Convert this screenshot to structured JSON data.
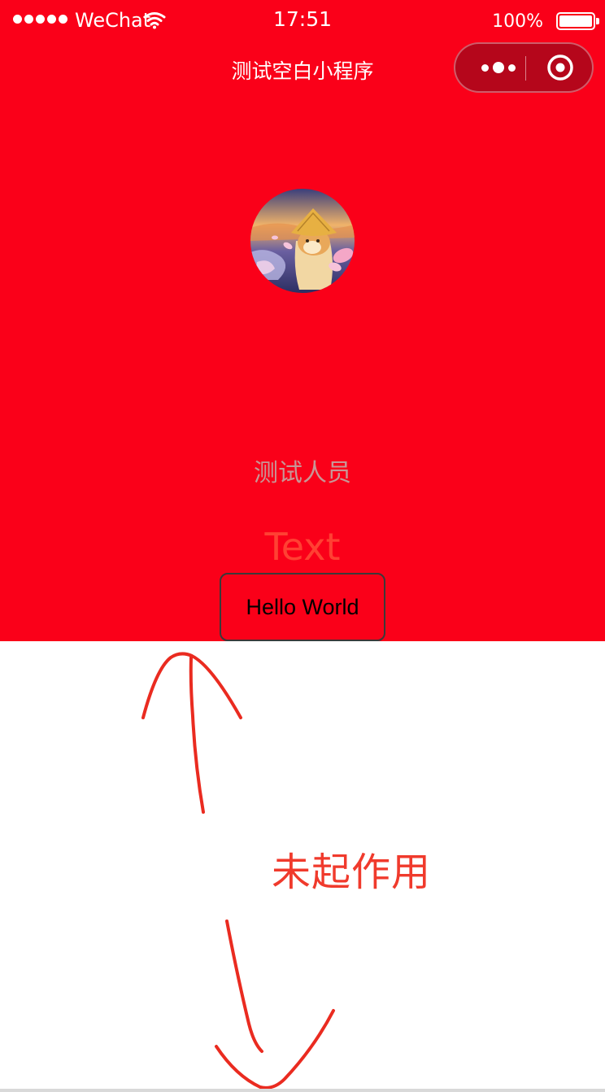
{
  "status_bar": {
    "carrier": "WeChat",
    "time": "17:51",
    "battery_percent": "100%",
    "signal_icon": "signal-dots-icon",
    "wifi_icon": "wifi-icon",
    "battery_icon": "battery-full-icon"
  },
  "nav_bar": {
    "title": "测试空白小程序",
    "more_icon": "more-dots-icon",
    "close_icon": "target-close-icon"
  },
  "page": {
    "avatar_icon": "shiba-avatar",
    "nickname": "测试人员",
    "text_label": "Text",
    "button_label": "Hello World",
    "background_color": "#fa0019"
  },
  "annotation": {
    "text": "未起作用",
    "color": "#f03a2c"
  }
}
